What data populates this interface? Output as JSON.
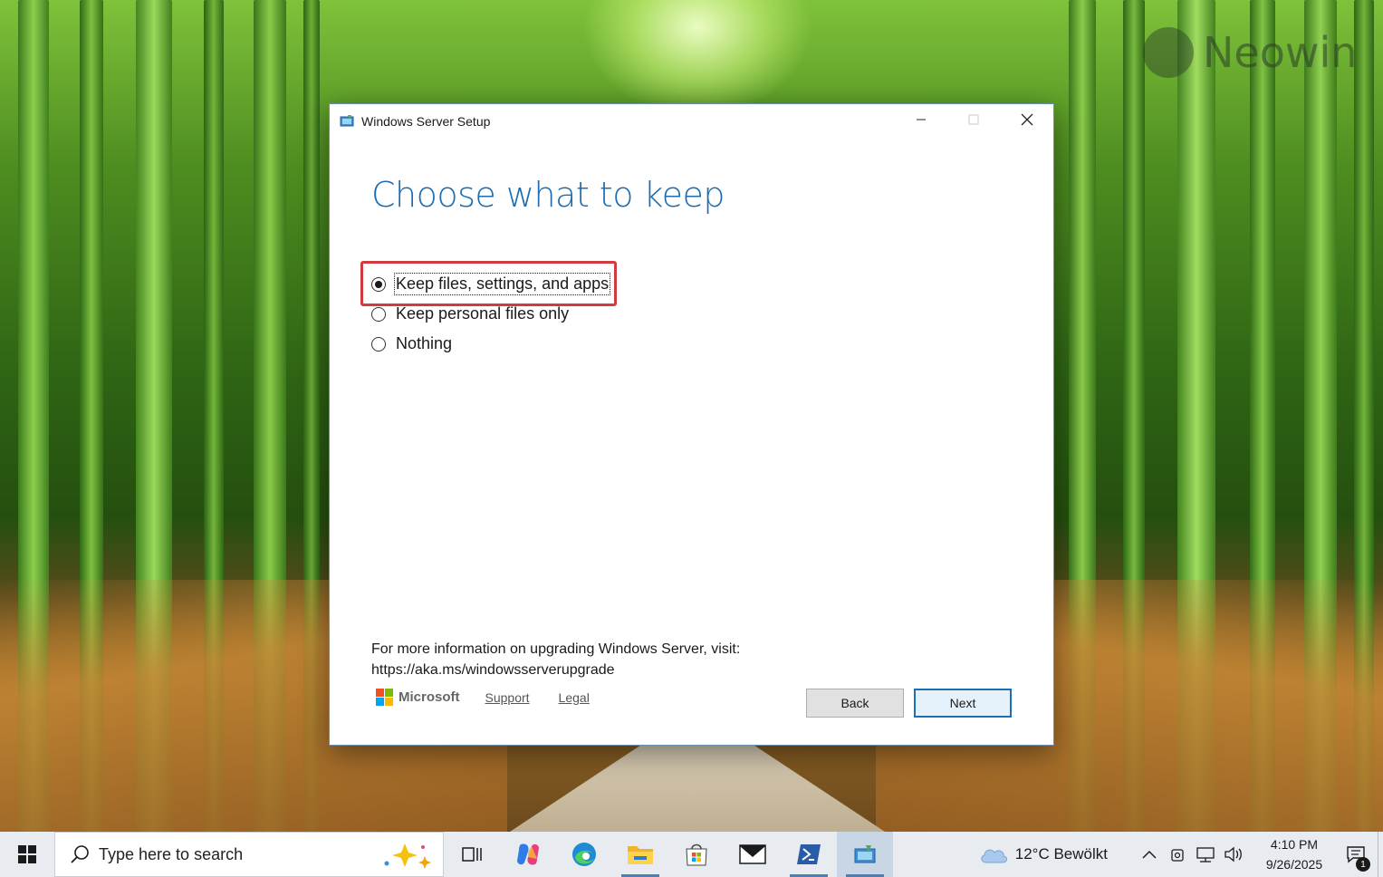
{
  "desktop": {
    "watermark": "Neowin"
  },
  "dialog": {
    "title": "Windows Server Setup",
    "heading": "Choose what to keep",
    "options": [
      {
        "label": "Keep files, settings, and apps",
        "selected": true
      },
      {
        "label": "Keep personal files only",
        "selected": false
      },
      {
        "label": "Nothing",
        "selected": false
      }
    ],
    "info_line1": "For more information on upgrading Windows Server, visit:",
    "info_line2": "https://aka.ms/windowsserverupgrade",
    "brand": "Microsoft",
    "support_link": "Support",
    "legal_link": "Legal",
    "back_button": "Back",
    "next_button": "Next",
    "highlight_color": "#d13a3f",
    "heading_color": "#1b6cb0"
  },
  "taskbar": {
    "search_placeholder": "Type here to search",
    "apps": [
      {
        "icon": "task-view-icon"
      },
      {
        "icon": "copilot-icon"
      },
      {
        "icon": "edge-icon"
      },
      {
        "icon": "file-explorer-icon"
      },
      {
        "icon": "microsoft-store-icon"
      },
      {
        "icon": "mail-icon"
      },
      {
        "icon": "powershell-icon"
      },
      {
        "icon": "setup-icon"
      }
    ],
    "weather": "12°C  Bewölkt",
    "time": "4:10 PM",
    "date": "9/26/2025",
    "notification_count": "1"
  }
}
